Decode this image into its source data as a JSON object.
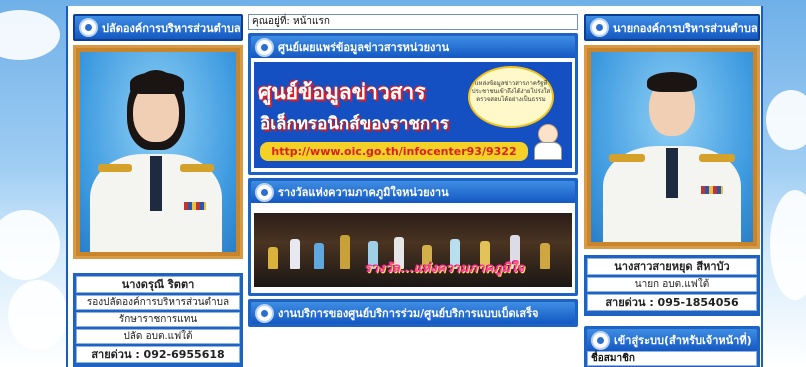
{
  "breadcrumb": {
    "text": "คุณอยู่ที่:  หน้าแรก"
  },
  "left": {
    "header": "ปลัดองค์การบริหารส่วนตำบล",
    "name": "นางดรุณี ริตตา",
    "position": "รองปลัดองค์การบริหารส่วนตำบล",
    "acting": "รักษาราชการแทน",
    "role": "ปลัด อบต.แฟใต้",
    "phone": "สายด่วน : 092-6955618"
  },
  "right": {
    "header": "นายกองค์การบริหารส่วนตำบล",
    "name": "นางสาวสายหยุด  สีหาบัว",
    "role": "นายก อบต.แฟใต้",
    "phone": "สายด่วน : 095-1854056",
    "login_header": "เข้าสู่ระบบ(สำหรับเจ้าหน้าที่)",
    "login_label": "ชื่อสมาชิก"
  },
  "center": {
    "info_header": "ศูนย์เผยแพร่ข้อมูลข่าวสารหน่วยงาน",
    "banner_title": "ศูนย์ข้อมูลข่าวสาร",
    "banner_subtitle": "อิเล็กทรอนิกส์ของราชการ",
    "banner_url": "http://www.oic.go.th/infocenter93/9322",
    "banner_bubble": "แหล่งข้อมูลข่าวสารภาครัฐที่ประชาชนเข้าถึงได้ง่ายโปร่งใสตรวจสอบได้อย่างเป็นธรรม",
    "award_header": "รางวัลแห่งความภาคภูมิใจหน่วยงาน",
    "award_caption": "รางวัล...แห่งความภาคภูมิใจ",
    "service_header": "งานบริการของศูนย์บริการร่วม/ศูนย์บริการแบบเบ็ดเสร็จ"
  },
  "colors": {
    "header_blue": "#1458c2",
    "photo_frame": "#c8852c",
    "url_bar": "#f3d126",
    "award_text": "#ff3a9b"
  }
}
